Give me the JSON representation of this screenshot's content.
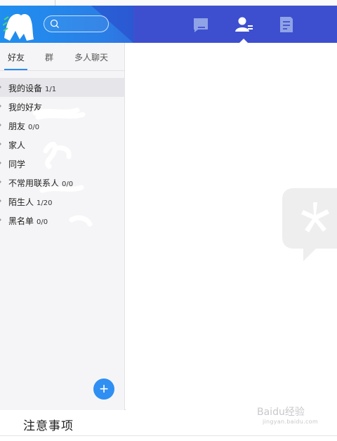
{
  "header": {
    "search_placeholder": "",
    "nav": [
      "message-icon",
      "contacts-icon",
      "notes-icon"
    ],
    "active_nav": "contacts-icon"
  },
  "tabs": [
    {
      "label": "好友",
      "active": true
    },
    {
      "label": "群",
      "active": false
    },
    {
      "label": "多人聊天",
      "active": false
    }
  ],
  "groups": [
    {
      "name": "我的设备",
      "count": "1/1",
      "selected": true
    },
    {
      "name": "我的好友",
      "count": "",
      "selected": false
    },
    {
      "name": "朋友",
      "count": "0/0",
      "selected": false
    },
    {
      "name": "家人",
      "count": "",
      "selected": false
    },
    {
      "name": "同学",
      "count": "",
      "selected": false
    },
    {
      "name": "不常用联系人",
      "count": "0/0",
      "selected": false
    },
    {
      "name": "陌生人",
      "count": "1/20",
      "selected": false
    },
    {
      "name": "黑名单",
      "count": "0/0",
      "selected": false
    }
  ],
  "add_button": "+",
  "footer": {
    "title": "注意事项"
  },
  "watermark": {
    "text": "Baidu经验",
    "sub": "jingyan.baidu.com"
  },
  "colors": {
    "header_start": "#1f8ff0",
    "header_end": "#4148c8",
    "accent": "#2f8ff2",
    "selected_row": "#e6e6ea"
  }
}
